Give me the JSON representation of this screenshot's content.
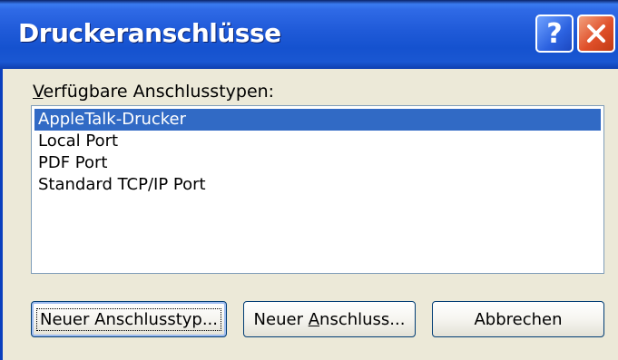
{
  "window": {
    "title": "Druckeranschlüsse",
    "help_glyph": "?",
    "close_icon": "close-icon"
  },
  "main": {
    "label_first": "V",
    "label_rest": "erfügbare Anschlusstypen:",
    "port_types": [
      "AppleTalk-Drucker",
      "Local Port",
      "PDF Port",
      "Standard TCP/IP Port"
    ],
    "selected_index": 0
  },
  "buttons": {
    "new_type": "Neuer Anschlusstyp...",
    "new_port_prefix": "Neuer ",
    "new_port_underlined": "A",
    "new_port_suffix": "nschluss...",
    "cancel": "Abbrechen"
  },
  "colors": {
    "selection": "#316ac5",
    "titlebar": "#1f5ad8",
    "close": "#e0502a"
  }
}
